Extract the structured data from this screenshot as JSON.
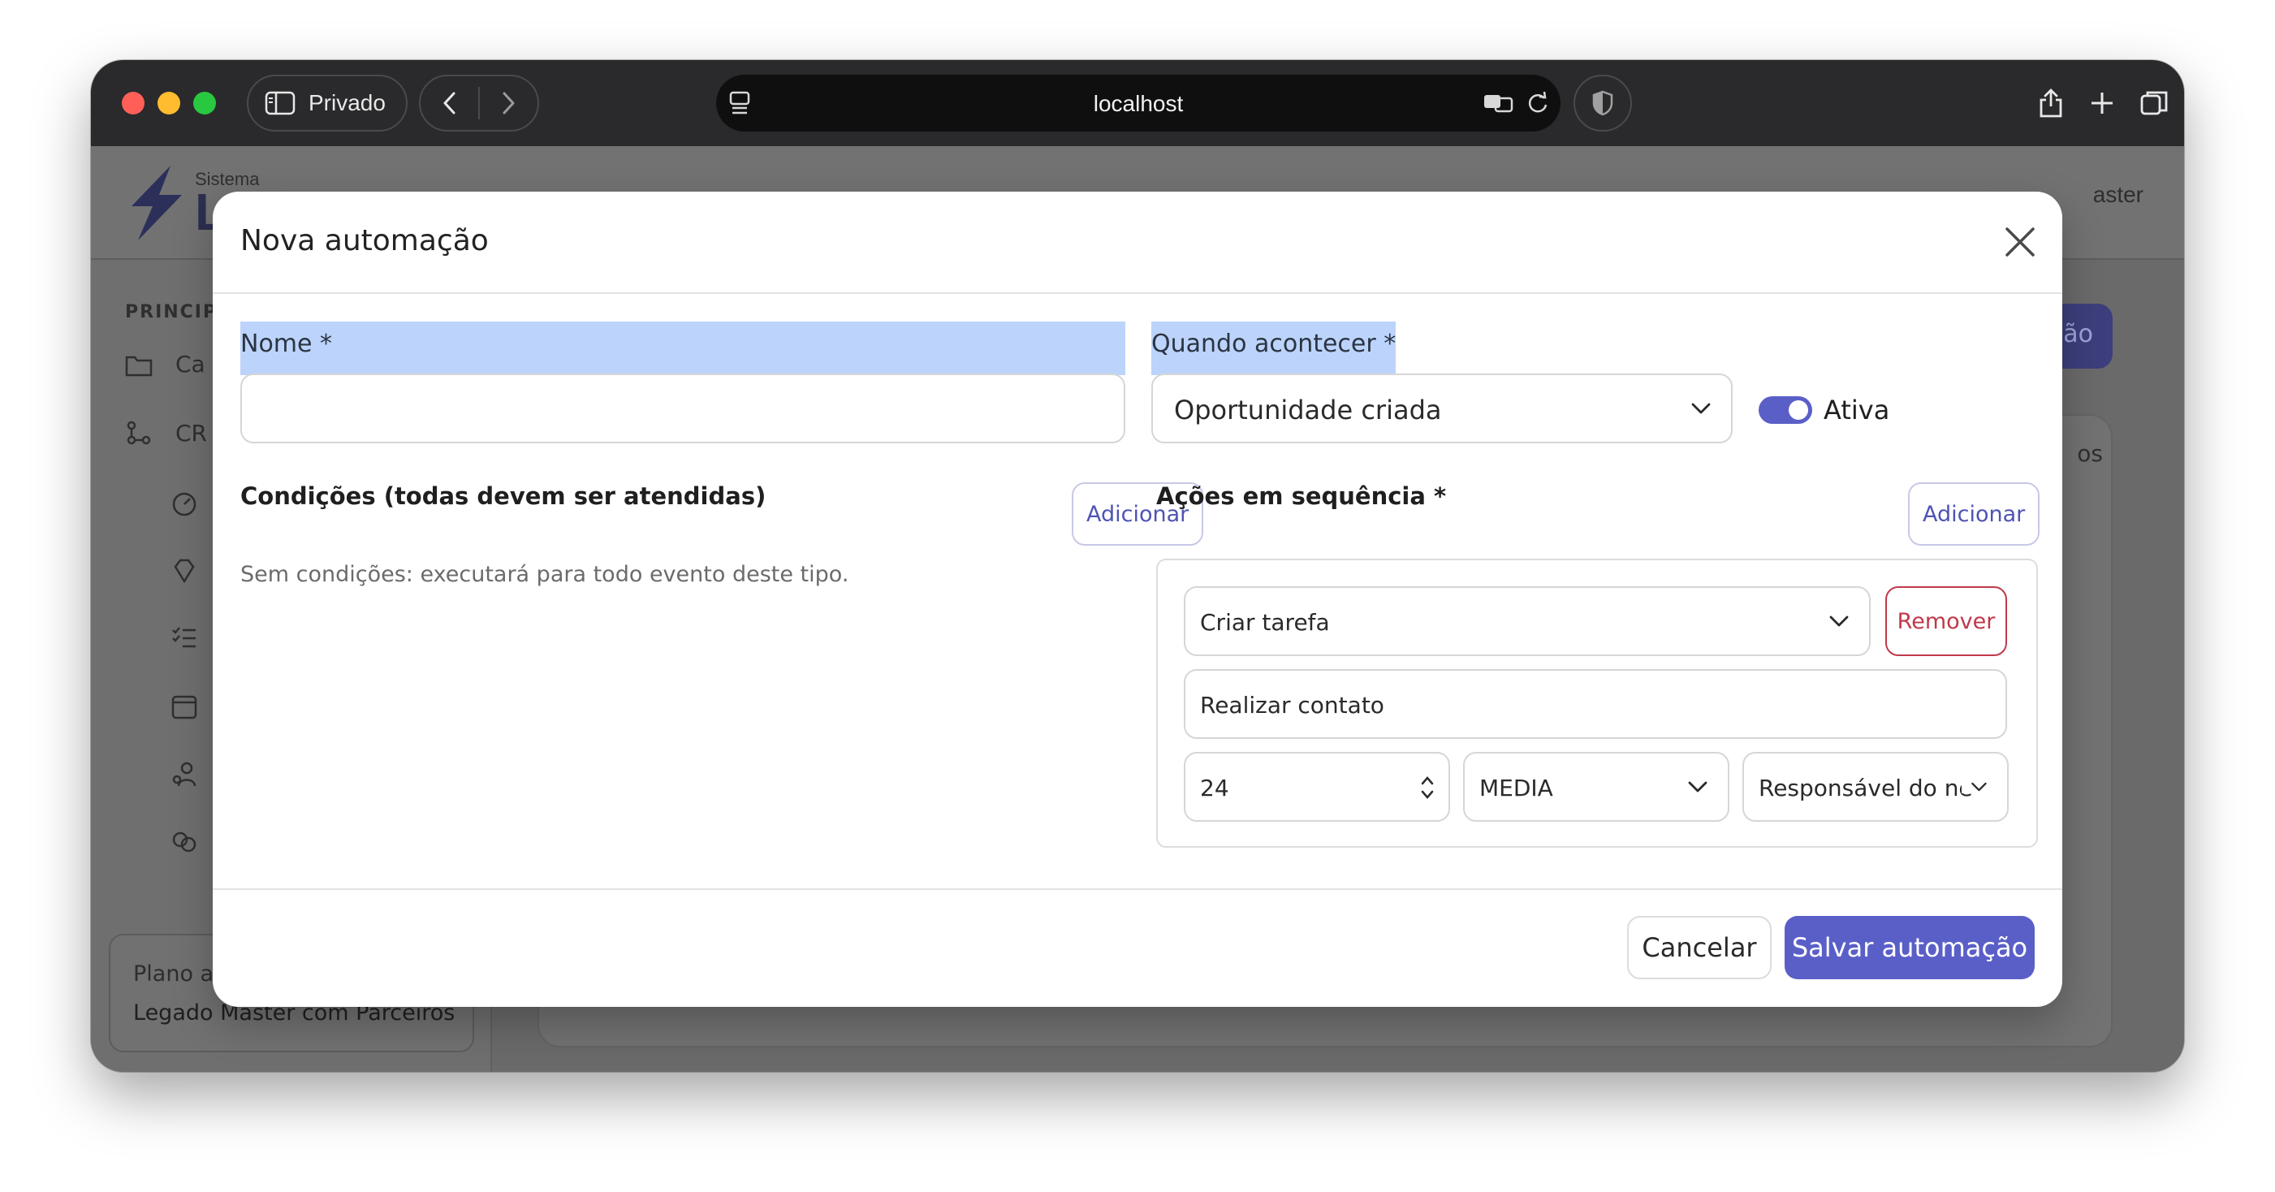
{
  "browser": {
    "private_label": "Privado",
    "url": "localhost"
  },
  "app": {
    "logo_small": "Sistema",
    "logo_big": "L",
    "header_user": "aster",
    "sidebar_section": "PRINCIPA",
    "sidebar_items": [
      "Ca",
      "CR"
    ],
    "plan_title": "Plano at",
    "plan_name": "Legado Master com Parceiros",
    "bg_button": "ão",
    "bg_tab_fragment": "os"
  },
  "modal": {
    "title": "Nova automação",
    "name_label": "Nome *",
    "name_value": "",
    "when_label": "Quando acontecer *",
    "event_value": "Oportunidade criada",
    "active_label": "Ativa",
    "active": true,
    "conditions_title": "Condições (todas devem ser atendidas)",
    "conditions_add": "Adicionar",
    "conditions_hint": "Sem condições: executará para todo evento deste tipo.",
    "actions_title": "Ações em sequência *",
    "actions_add": "Adicionar",
    "action": {
      "type": "Criar tarefa",
      "remove_label": "Remover",
      "task_title": "Realizar contato",
      "hours": "24",
      "priority": "MEDIA",
      "assignee": "Responsável do ne"
    },
    "cancel_label": "Cancelar",
    "save_label": "Salvar automação"
  },
  "colors": {
    "accent": "#5a5fc8",
    "danger": "#c0394a",
    "highlight": "#bcd4fb"
  }
}
